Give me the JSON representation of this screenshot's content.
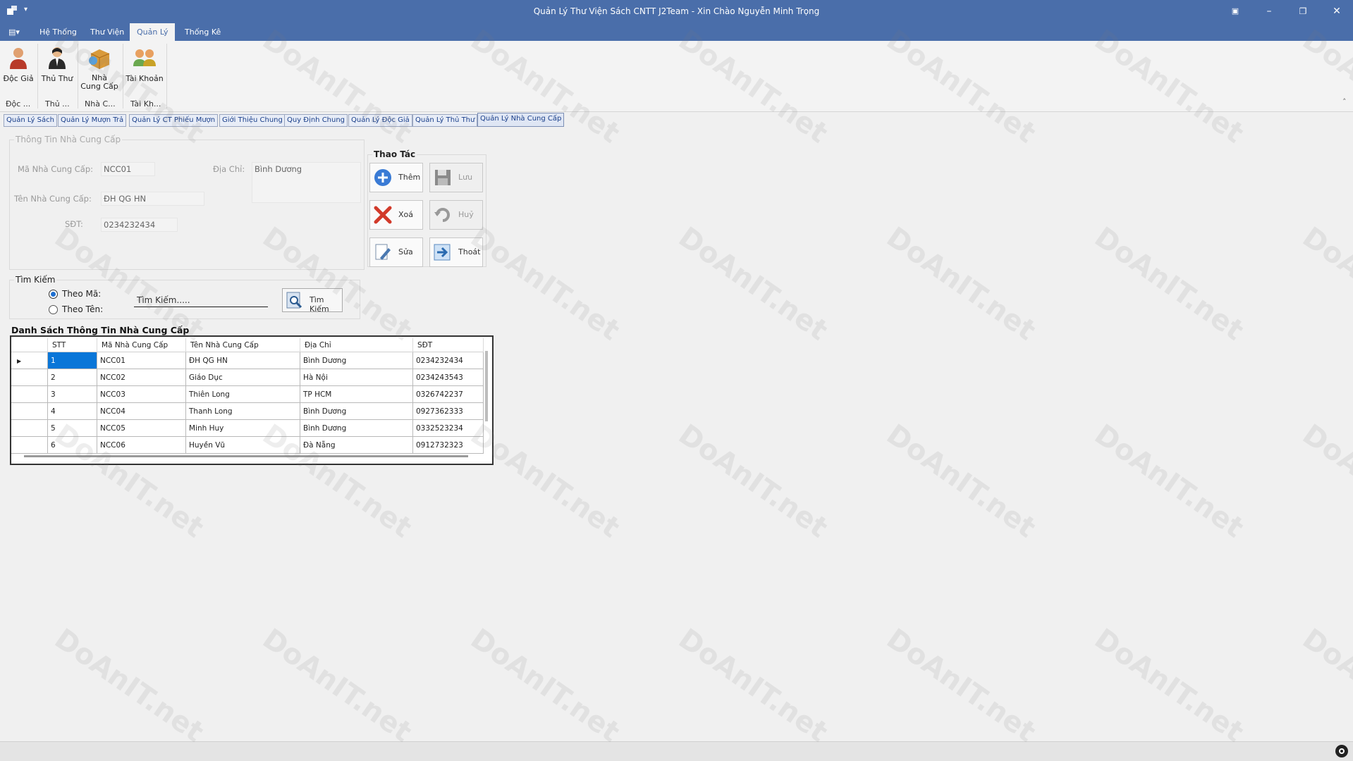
{
  "window": {
    "title": "Quản Lý Thư Viện Sách CNTT J2Team - Xin Chào Nguyễn Minh Trọng"
  },
  "ribbon_tabs": [
    "Hệ Thống",
    "Thư Viện",
    "Quản Lý",
    "Thống Kê"
  ],
  "ribbon": {
    "buttons": [
      {
        "label": "Độc Giả"
      },
      {
        "label": "Thủ Thư"
      },
      {
        "label": "Nhà Cung Cấp"
      },
      {
        "label": "Tài Khoản"
      }
    ],
    "groups": [
      "Độc ...",
      "Thủ ...",
      "Nhà C...",
      "Tài Kh..."
    ]
  },
  "doc_tabs": [
    "Quản Lý Sách",
    "Quản Lý Mượn Trả",
    "Quản Lý CT Phiếu Mượn",
    "Giới Thiệu Chung",
    "Quy Định Chung",
    "Quản Lý Độc Giả",
    "Quản Lý Thủ Thư",
    "Quản Lý Nhà Cung Cấp"
  ],
  "info": {
    "title": "Thông Tin Nhà Cung Cấp",
    "ma_label": "Mã Nhà Cung Cấp:",
    "ma_value": "NCC01",
    "diachi_label": "Địa Chỉ:",
    "diachi_value": "Bình Dương",
    "ten_label": "Tên Nhà Cung Cấp:",
    "ten_value": "ĐH QG HN",
    "sdt_label": "SĐT:",
    "sdt_value": "0234232434"
  },
  "actions": {
    "title": "Thao Tác",
    "them": "Thêm",
    "luu": "Lưu",
    "xoa": "Xoá",
    "huy": "Huỷ",
    "sua": "Sửa",
    "thoat": "Thoát"
  },
  "search": {
    "title": "Tìm Kiếm",
    "by_code": "Theo Mã:",
    "by_name": "Theo Tên:",
    "input": "Tìm Kiếm.....",
    "button": "Tìm Kiếm"
  },
  "table": {
    "title": "Danh Sách Thông Tin Nhà Cung Cấp",
    "columns": [
      "STT",
      "Mã Nhà Cung Cấp",
      "Tên Nhà Cung Cấp",
      "Địa Chỉ",
      "SĐT"
    ],
    "rows": [
      [
        "1",
        "NCC01",
        "ĐH QG HN",
        "Bình Dương",
        "0234232434"
      ],
      [
        "2",
        "NCC02",
        "Giáo Dục",
        "Hà Nội",
        "0234243543"
      ],
      [
        "3",
        "NCC03",
        "Thiên Long",
        "TP HCM",
        "0326742237"
      ],
      [
        "4",
        "NCC04",
        "Thanh Long",
        "Bình Dương",
        "0927362333"
      ],
      [
        "5",
        "NCC05",
        "Minh Huy",
        "Bình Dương",
        "0332523234"
      ],
      [
        "6",
        "NCC06",
        "Huyền Vũ",
        "Đà Nẵng",
        "0912732323"
      ]
    ]
  },
  "watermark": {
    "text": "DoAnIT.net"
  }
}
